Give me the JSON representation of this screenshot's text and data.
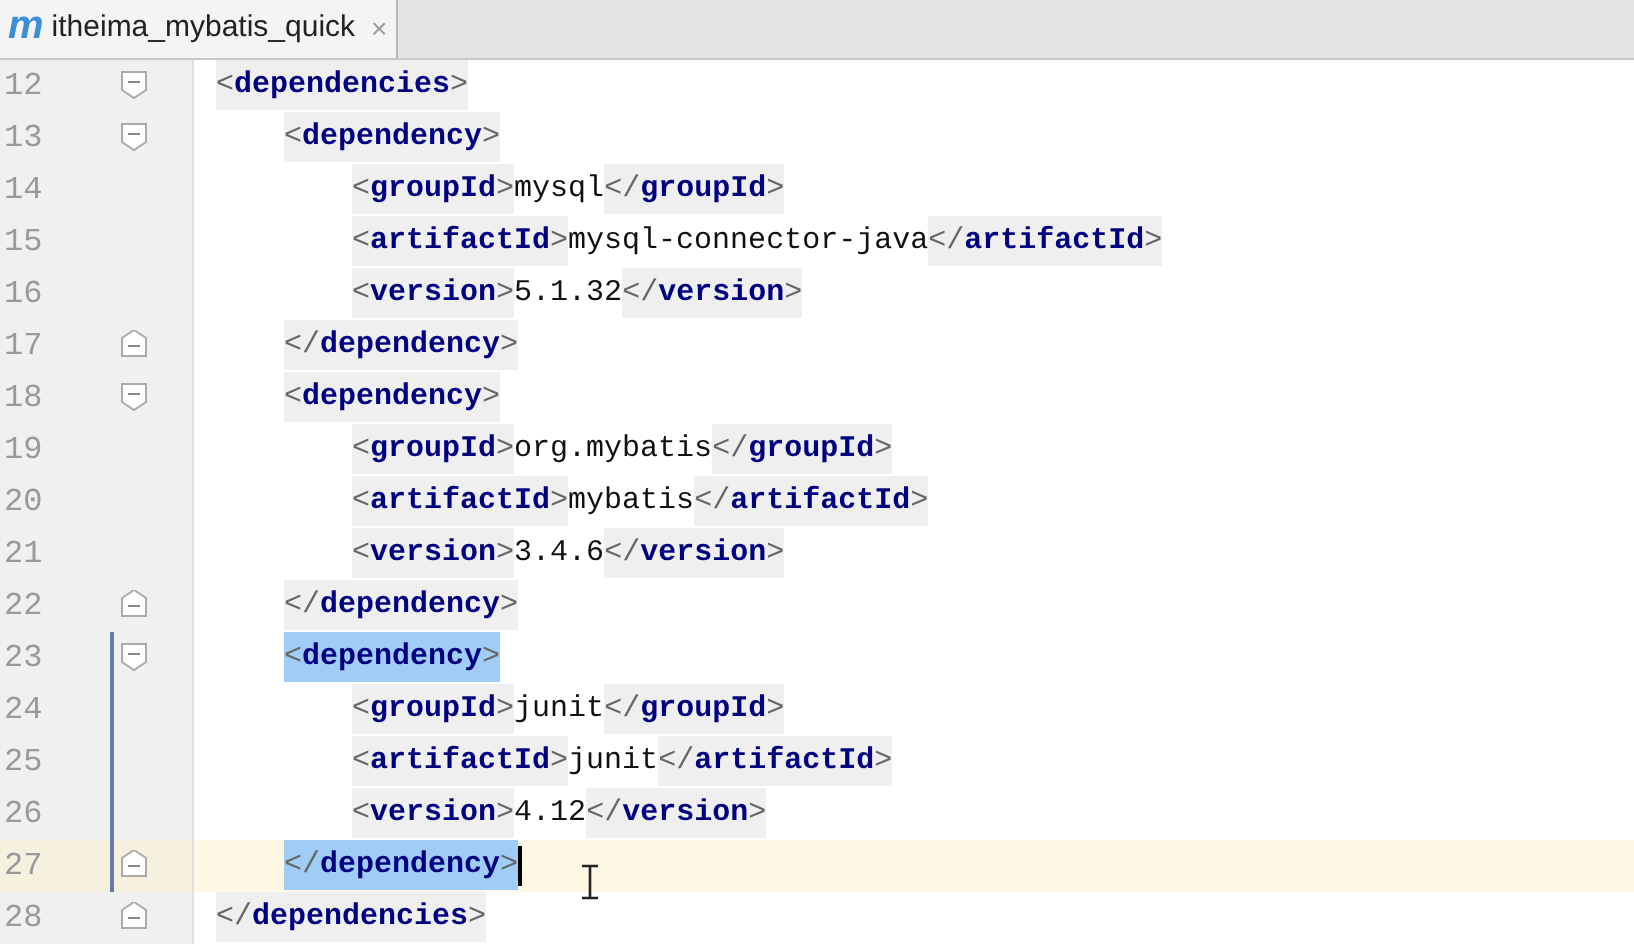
{
  "tab": {
    "icon_letter": "m",
    "title": "itheima_mybatis_quick",
    "close": "×",
    "selected": true
  },
  "elements": [
    {
      "kind": "block",
      "start": "12",
      "end": "28",
      "open": {
        "lt": "<",
        "name": "dependencies",
        "gt": ">"
      },
      "close": {
        "lt": "</",
        "name": "dependencies",
        "gt": ">"
      },
      "matched": false,
      "cursor": false,
      "children": [
        {
          "kind": "block",
          "start": "13",
          "end": "17",
          "open": {
            "lt": "<",
            "name": "dependency",
            "gt": ">"
          },
          "close": {
            "lt": "</",
            "name": "dependency",
            "gt": ">"
          },
          "matched": false,
          "cursor": false,
          "children": [
            {
              "kind": "leaf",
              "line": "14",
              "open": {
                "lt": "<",
                "name": "groupId",
                "gt": ">"
              },
              "value": "mysql",
              "close": {
                "lt": "</",
                "name": "groupId",
                "gt": ">"
              }
            },
            {
              "kind": "leaf",
              "line": "15",
              "open": {
                "lt": "<",
                "name": "artifactId",
                "gt": ">"
              },
              "value": "mysql-connector-java",
              "close": {
                "lt": "</",
                "name": "artifactId",
                "gt": ">"
              }
            },
            {
              "kind": "leaf",
              "line": "16",
              "open": {
                "lt": "<",
                "name": "version",
                "gt": ">"
              },
              "value": "5.1.32",
              "close": {
                "lt": "</",
                "name": "version",
                "gt": ">"
              }
            }
          ]
        },
        {
          "kind": "block",
          "start": "18",
          "end": "22",
          "open": {
            "lt": "<",
            "name": "dependency",
            "gt": ">"
          },
          "close": {
            "lt": "</",
            "name": "dependency",
            "gt": ">"
          },
          "matched": false,
          "cursor": false,
          "children": [
            {
              "kind": "leaf",
              "line": "19",
              "open": {
                "lt": "<",
                "name": "groupId",
                "gt": ">"
              },
              "value": "org.mybatis",
              "close": {
                "lt": "</",
                "name": "groupId",
                "gt": ">"
              }
            },
            {
              "kind": "leaf",
              "line": "20",
              "open": {
                "lt": "<",
                "name": "artifactId",
                "gt": ">"
              },
              "value": "mybatis",
              "close": {
                "lt": "</",
                "name": "artifactId",
                "gt": ">"
              }
            },
            {
              "kind": "leaf",
              "line": "21",
              "open": {
                "lt": "<",
                "name": "version",
                "gt": ">"
              },
              "value": "3.4.6",
              "close": {
                "lt": "</",
                "name": "version",
                "gt": ">"
              }
            }
          ]
        },
        {
          "kind": "block",
          "start": "23",
          "end": "27",
          "open": {
            "lt": "<",
            "name": "dependency",
            "gt": ">"
          },
          "close": {
            "lt": "</",
            "name": "dependency",
            "gt": ">"
          },
          "matched": true,
          "cursor": true,
          "children": [
            {
              "kind": "leaf",
              "line": "24",
              "open": {
                "lt": "<",
                "name": "groupId",
                "gt": ">"
              },
              "value": "junit",
              "close": {
                "lt": "</",
                "name": "groupId",
                "gt": ">"
              }
            },
            {
              "kind": "leaf",
              "line": "25",
              "open": {
                "lt": "<",
                "name": "artifactId",
                "gt": ">"
              },
              "value": "junit",
              "close": {
                "lt": "</",
                "name": "artifactId",
                "gt": ">"
              }
            },
            {
              "kind": "leaf",
              "line": "26",
              "open": {
                "lt": "<",
                "name": "version",
                "gt": ">"
              },
              "value": "4.12",
              "close": {
                "lt": "</",
                "name": "version",
                "gt": ">"
              }
            }
          ]
        }
      ]
    }
  ]
}
